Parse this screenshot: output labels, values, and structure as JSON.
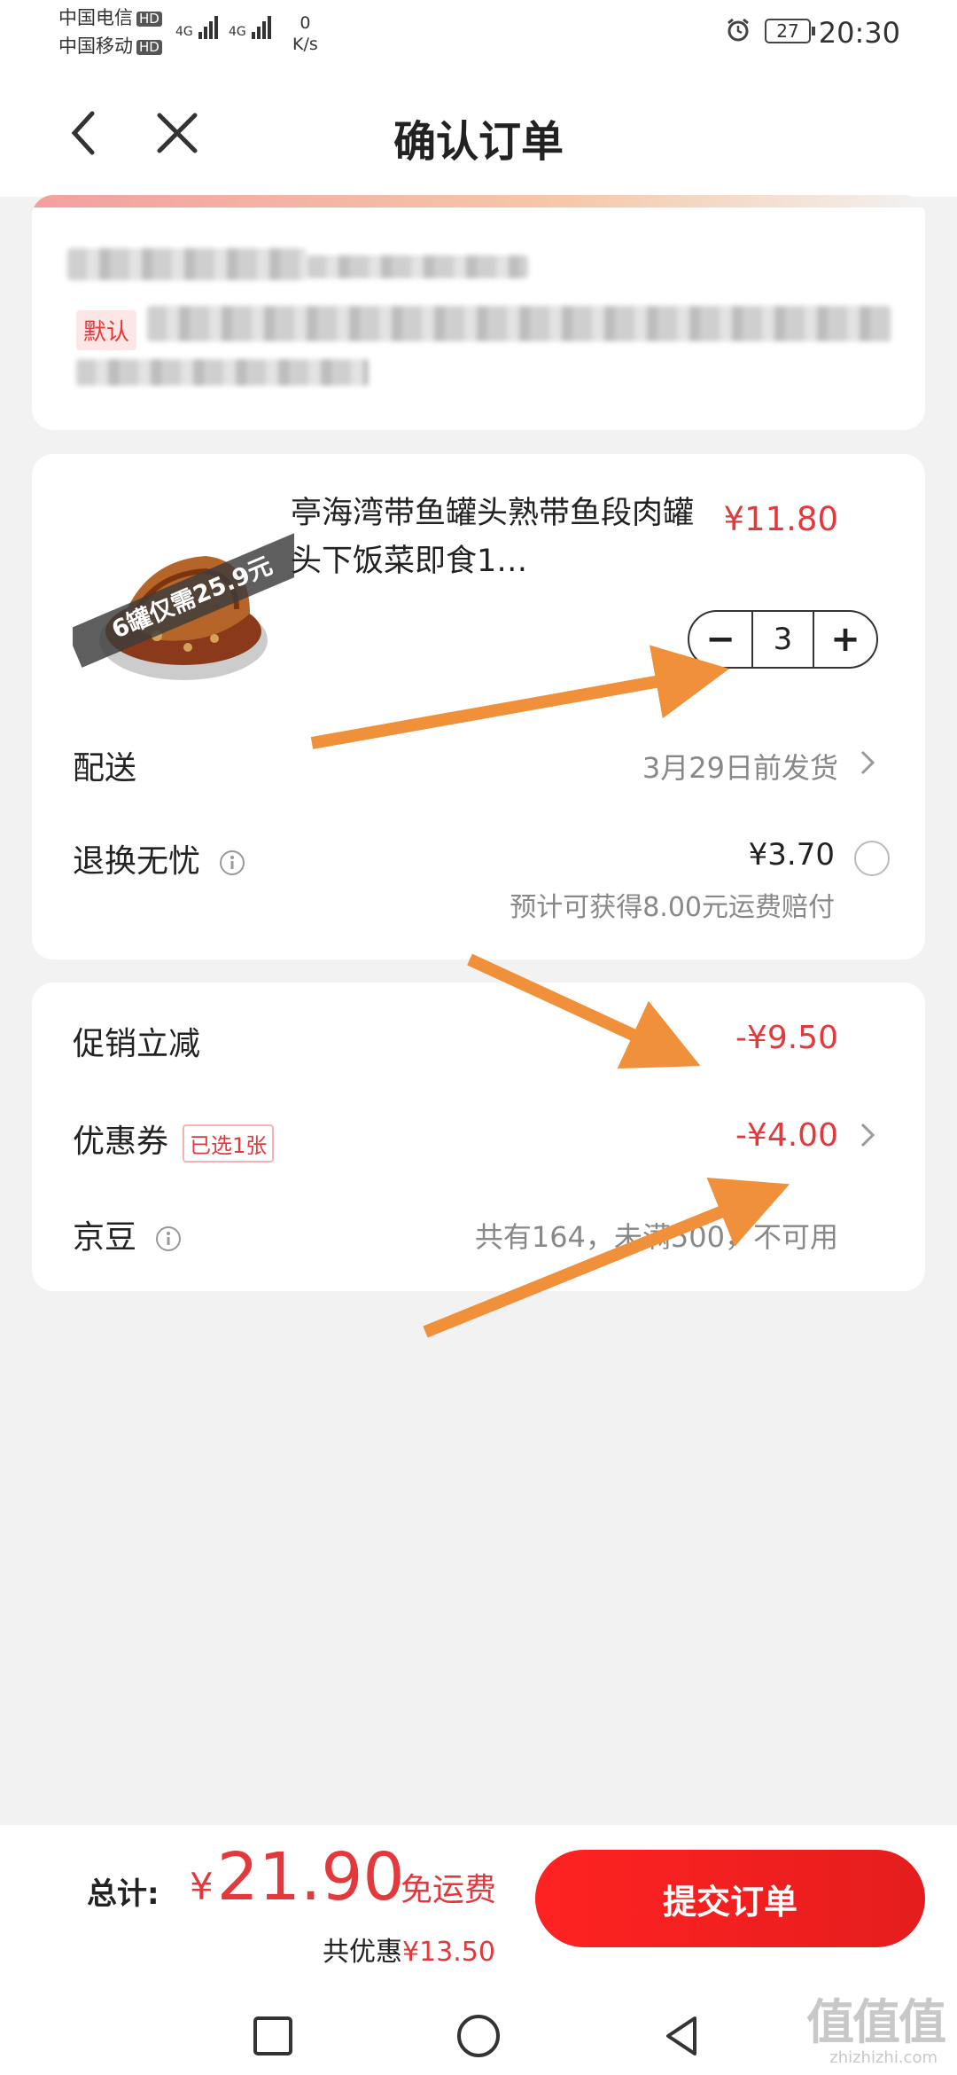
{
  "status_bar": {
    "carrier1": "中国电信",
    "carrier2": "中国移动",
    "hd": "HD",
    "signal_label": "4G",
    "net_speed_value": "0",
    "net_speed_unit": "K/s",
    "battery": "27",
    "time": "20:30"
  },
  "header": {
    "title": "确认订单"
  },
  "address": {
    "default_tag": "默认"
  },
  "product": {
    "name": "亭海湾带鱼罐头熟带鱼段肉罐头下饭菜即食1…",
    "image_banner": "6罐仅需25.9元",
    "price": "¥11.80",
    "quantity": "3",
    "minus": "−",
    "plus": "+"
  },
  "delivery": {
    "label": "配送",
    "value": "3月29日前发货"
  },
  "return_service": {
    "label": "退换无忧",
    "price": "¥3.70",
    "note": "预计可获得8.00元运费赔付"
  },
  "promo": {
    "discount_label": "促销立减",
    "discount_value": "-¥9.50",
    "coupon_label": "优惠券",
    "coupon_tag": "已选1张",
    "coupon_value": "-¥4.00",
    "jingdou_label": "京豆",
    "jingdou_value": "共有164，未满500，不可用"
  },
  "footer": {
    "total_label": "总计:",
    "currency": "¥",
    "total_amount": "21.90",
    "free_shipping": "免运费",
    "saving_label": "共优惠",
    "saving_value": "¥13.50",
    "submit_label": "提交订单"
  },
  "watermark": {
    "text": "值值值",
    "sub": "zhizhizhi.com"
  },
  "colors": {
    "accent": "#e4393c",
    "arrow": "#f0903a"
  }
}
